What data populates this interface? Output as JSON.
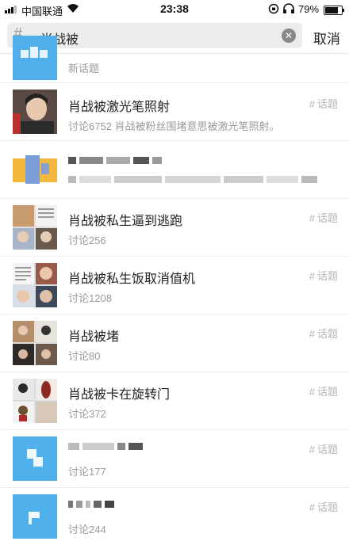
{
  "status": {
    "carrier": "中国联通",
    "time": "23:38",
    "battery": "79%"
  },
  "search": {
    "query": "肖战被",
    "cancel": "取消"
  },
  "topics": [
    {
      "title": "",
      "sub": "新话题",
      "tag": ""
    },
    {
      "title": "肖战被激光笔照射",
      "sub": "讨论6752 肖战被粉丝围堵意思被激光笔照射。",
      "tag": "话题"
    },
    {
      "title": "",
      "sub": "",
      "tag": ""
    },
    {
      "title": "肖战被私生逼到逃跑",
      "sub": "讨论256",
      "tag": "话题"
    },
    {
      "title": "肖战被私生饭取消值机",
      "sub": "讨论1208",
      "tag": "话题"
    },
    {
      "title": "肖战被堵",
      "sub": "讨论80",
      "tag": "话题"
    },
    {
      "title": "肖战被卡在旋转门",
      "sub": "讨论372",
      "tag": "话题"
    },
    {
      "title": "",
      "sub": "讨论177",
      "tag": "话题"
    },
    {
      "title": "",
      "sub": "讨论244",
      "tag": "话题"
    }
  ]
}
